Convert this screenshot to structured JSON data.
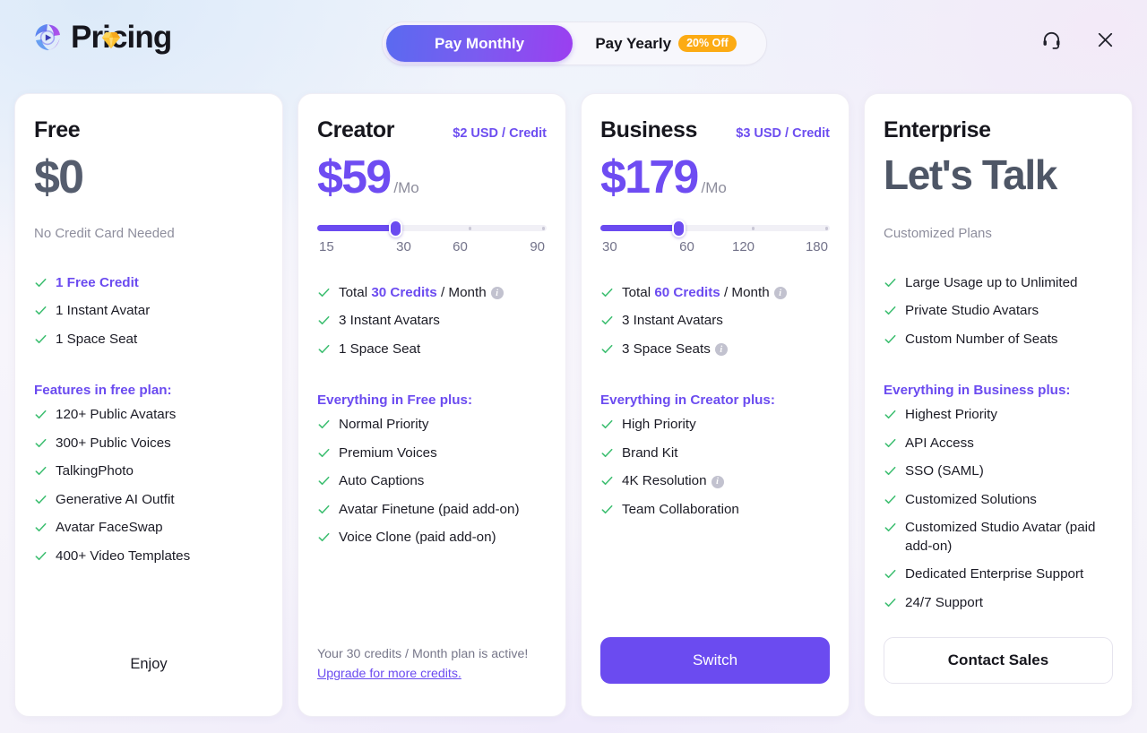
{
  "header": {
    "brand_title": "Pricing",
    "logo_icon": "playcircle-gradient-logo",
    "gem_icon": "diamond-gem-icon",
    "toggle": {
      "monthly_label": "Pay Monthly",
      "yearly_label": "Pay Yearly",
      "discount_badge": "20% Off",
      "selected": "Pay Monthly"
    },
    "support_icon": "headset-icon",
    "close_icon": "close-icon"
  },
  "colors": {
    "accent_purple": "#6b4bf0",
    "check_green": "#3fbf72",
    "badge_orange": "#fcab14",
    "price_gray": "#555d6e"
  },
  "plans": [
    {
      "name": "Free",
      "rate": "",
      "price": "$0",
      "per": "",
      "subnote": "No Credit Card Needed",
      "has_slider": false,
      "top_features": [
        {
          "text": "1 Free Credit",
          "accent": true,
          "info": false
        },
        {
          "text": "1 Instant Avatar",
          "accent": false,
          "info": false
        },
        {
          "text": "1 Space Seat",
          "accent": false,
          "info": false
        }
      ],
      "section_title": "Features in free plan:",
      "features": [
        {
          "text": "120+ Public Avatars",
          "info": false
        },
        {
          "text": "300+ Public Voices",
          "info": false
        },
        {
          "text": "TalkingPhoto",
          "info": false
        },
        {
          "text": "Generative AI Outfit",
          "info": false
        },
        {
          "text": "Avatar FaceSwap",
          "info": false
        },
        {
          "text": "400+ Video Templates",
          "info": false
        }
      ],
      "footer_type": "text",
      "footer_label": "Enjoy"
    },
    {
      "name": "Creator",
      "rate": "$2 USD / Credit",
      "price": "$59",
      "per": "/Mo",
      "subnote": "",
      "has_slider": true,
      "slider": {
        "ticks": [
          "15",
          "30",
          "60",
          "90"
        ],
        "value": "30",
        "fill_percent": 34,
        "dot_percent": [
          66,
          98
        ]
      },
      "top_features": [
        {
          "text": "Total |30 Credits| / Month",
          "accent": false,
          "info": true
        },
        {
          "text": "3 Instant Avatars",
          "accent": false,
          "info": false
        },
        {
          "text": "1 Space Seat",
          "accent": false,
          "info": false
        }
      ],
      "section_title": "Everything in Free plus:",
      "features": [
        {
          "text": "Normal Priority",
          "info": false
        },
        {
          "text": "Premium Voices",
          "info": false
        },
        {
          "text": "Auto Captions",
          "info": false
        },
        {
          "text": "Avatar Finetune (paid add-on)",
          "info": false
        },
        {
          "text": "Voice Clone (paid add-on)",
          "info": false
        }
      ],
      "footer_type": "note",
      "footer_note_prefix": "Your 30 credits / Month plan is active! ",
      "footer_note_link": "Upgrade for more credits."
    },
    {
      "name": "Business",
      "rate": "$3 USD / Credit",
      "price": "$179",
      "per": "/Mo",
      "subnote": "",
      "has_slider": true,
      "slider": {
        "ticks": [
          "30",
          "60",
          "120",
          "180"
        ],
        "value": "60",
        "fill_percent": 34,
        "dot_percent": [
          66,
          98
        ]
      },
      "top_features": [
        {
          "text": "Total |60 Credits| / Month",
          "accent": false,
          "info": true
        },
        {
          "text": "3 Instant Avatars",
          "accent": false,
          "info": false
        },
        {
          "text": "3 Space Seats",
          "accent": false,
          "info": true
        }
      ],
      "section_title": "Everything in Creator plus:",
      "features": [
        {
          "text": "High Priority",
          "info": false
        },
        {
          "text": "Brand Kit",
          "info": false
        },
        {
          "text": "4K Resolution",
          "info": true
        },
        {
          "text": "Team Collaboration",
          "info": false
        }
      ],
      "footer_type": "primary",
      "footer_label": "Switch"
    },
    {
      "name": "Enterprise",
      "rate": "",
      "price": "Let's Talk",
      "per": "",
      "subnote": "Customized Plans",
      "has_slider": false,
      "top_features": [
        {
          "text": "Large Usage up to Unlimited",
          "accent": false,
          "info": false
        },
        {
          "text": "Private Studio Avatars",
          "accent": false,
          "info": false
        },
        {
          "text": "Custom Number of Seats",
          "accent": false,
          "info": false
        }
      ],
      "section_title": "Everything in Business plus:",
      "features": [
        {
          "text": "Highest Priority",
          "info": false
        },
        {
          "text": "API Access",
          "info": false
        },
        {
          "text": "SSO (SAML)",
          "info": false
        },
        {
          "text": "Customized Solutions",
          "info": false
        },
        {
          "text": "Customized Studio Avatar (paid add-on)",
          "info": false
        },
        {
          "text": "Dedicated Enterprise Support",
          "info": false
        },
        {
          "text": "24/7 Support",
          "info": false
        }
      ],
      "footer_type": "outline",
      "footer_label": "Contact Sales"
    }
  ]
}
